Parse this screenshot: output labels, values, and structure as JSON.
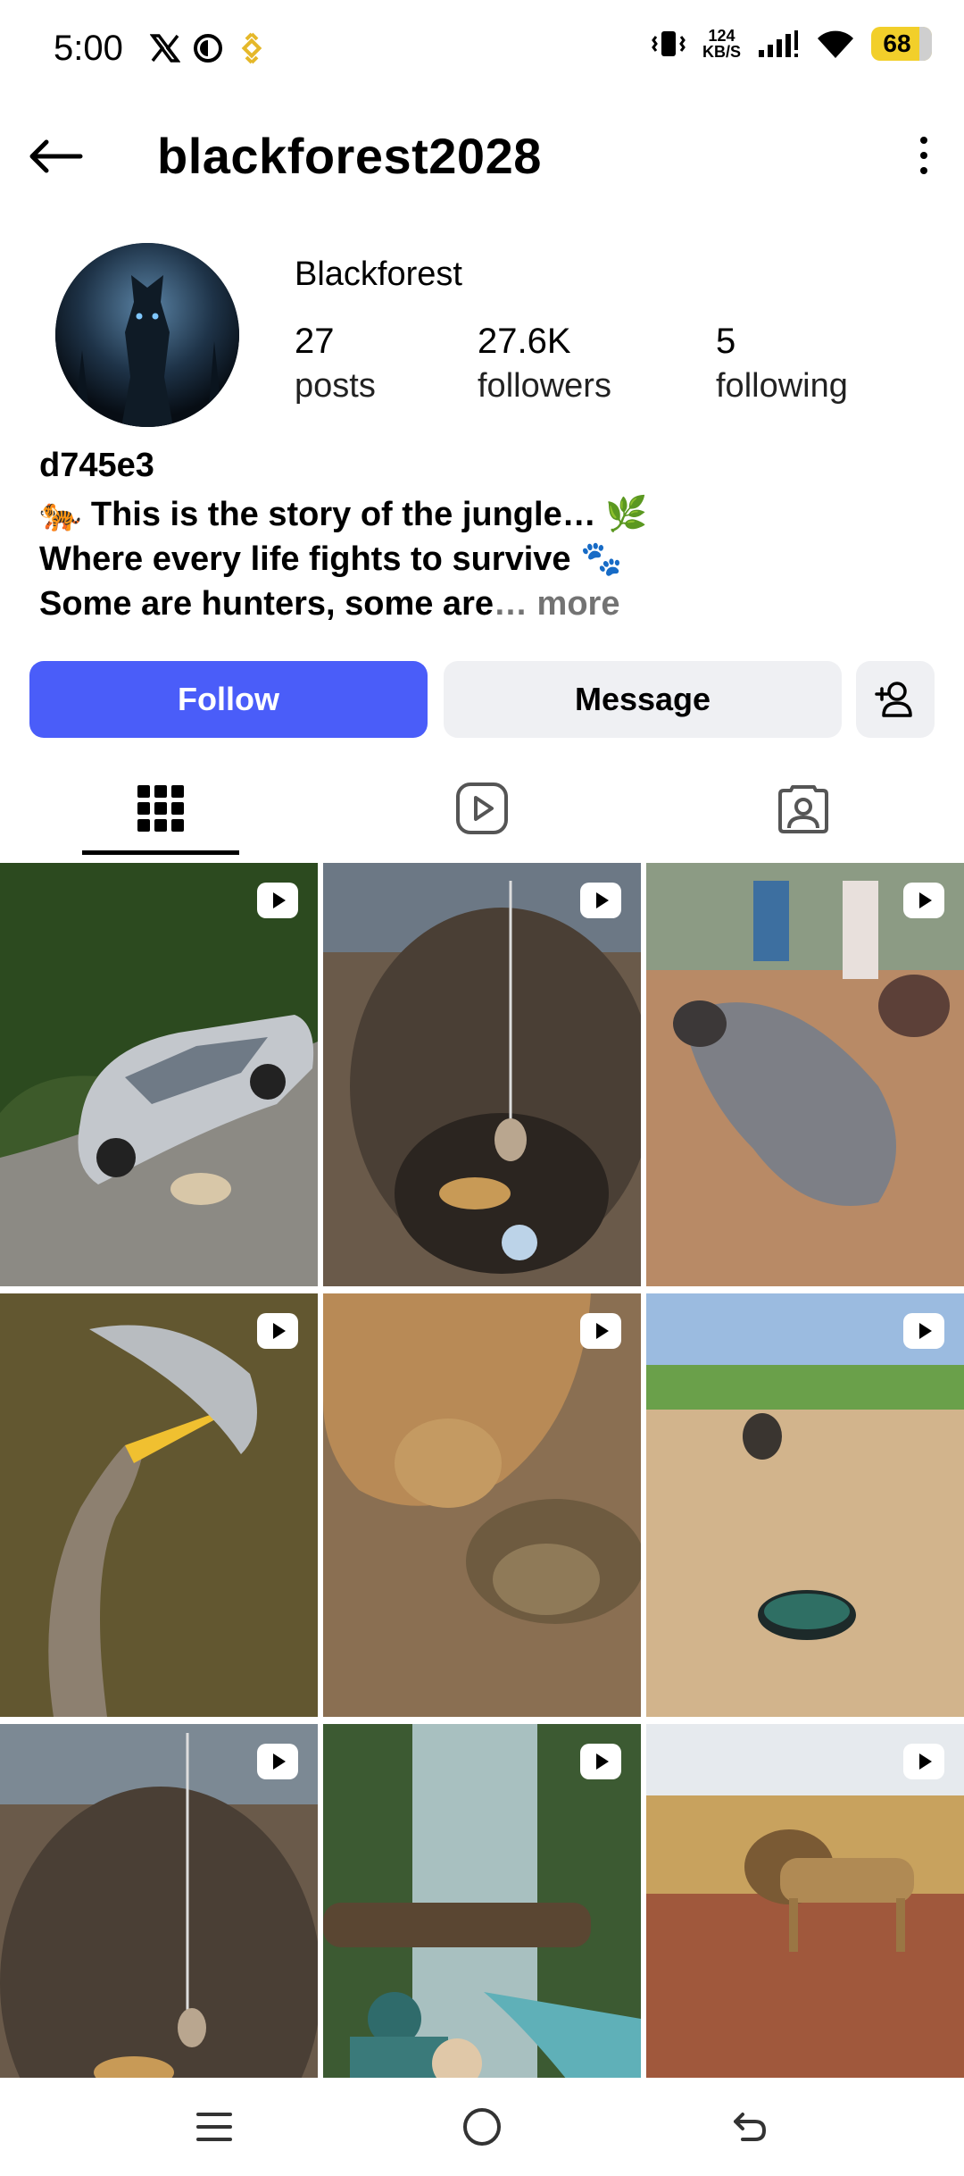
{
  "status_bar": {
    "time": "5:00",
    "net_speed_top": "124",
    "net_speed_bottom": "KB/S",
    "battery": "68",
    "icons": [
      "x-logo-icon",
      "vpn-icon",
      "binance-icon",
      "vibrate-icon",
      "signal-icon",
      "wifi-icon",
      "battery-icon"
    ]
  },
  "header": {
    "username": "blackforest2028",
    "icons": [
      "back-arrow-icon",
      "more-vertical-icon"
    ]
  },
  "profile": {
    "display_name": "Blackforest",
    "stats": {
      "posts": {
        "value": "27",
        "label": "posts"
      },
      "followers": {
        "value": "27.6K",
        "label": "followers"
      },
      "following": {
        "value": "5",
        "label": "following"
      }
    },
    "bio_name": "d745e3",
    "bio_lines": [
      "🐅 This is the story of the jungle… 🌿",
      "Where every life fights to survive 🐾",
      "Some are hunters, some are"
    ],
    "bio_more": "… more"
  },
  "actions": {
    "follow": "Follow",
    "message": "Message",
    "colors": {
      "follow_bg": "#4a5df9",
      "message_bg": "#eff0f3"
    }
  },
  "tabs": [
    "grid-icon",
    "reels-icon",
    "tagged-icon"
  ],
  "grid": {
    "posts": [
      {
        "type": "reel",
        "subject": "car and leopard on forest road"
      },
      {
        "type": "reel",
        "subject": "leopard in well"
      },
      {
        "type": "reel",
        "subject": "giant catfish"
      },
      {
        "type": "reel",
        "subject": "bird catching fish"
      },
      {
        "type": "reel",
        "subject": "hyena and tortoise"
      },
      {
        "type": "reel",
        "subject": "buffalo and hole"
      },
      {
        "type": "reel",
        "subject": "leopard in well"
      },
      {
        "type": "reel",
        "subject": "waterfall photographers"
      },
      {
        "type": "reel",
        "subject": "lion on cliff"
      }
    ]
  },
  "navbar": [
    "menu-icon",
    "home-circle-icon",
    "back-icon"
  ]
}
